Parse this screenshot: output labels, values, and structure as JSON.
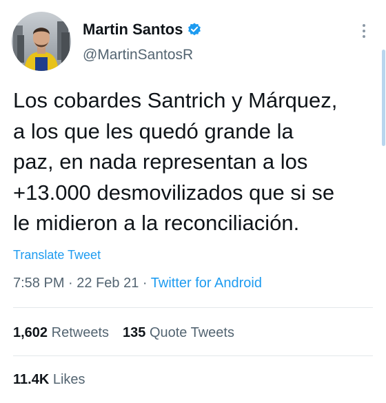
{
  "author": {
    "display_name": "Martin Santos",
    "handle": "@MartinSantosR",
    "verified_icon": "verified-badge-icon"
  },
  "tweet": {
    "text": "Los cobardes Santrich y Márquez,\na los que les quedó grande la\npaz, en nada representan a los\n+13.000 desmovilizados que si se\nle midieron a la reconciliación.",
    "translate_label": "Translate Tweet",
    "time": "7:58 PM",
    "separator": "·",
    "date": "22 Feb 21",
    "source": "Twitter for Android"
  },
  "stats": {
    "retweets_count": "1,602",
    "retweets_label": "Retweets",
    "quotes_count": "135",
    "quotes_label": "Quote Tweets",
    "likes_count": "11.4K",
    "likes_label": "Likes"
  },
  "colors": {
    "accent": "#1d9bf0",
    "secondary_text": "#536471",
    "primary_text": "#0f1419"
  }
}
